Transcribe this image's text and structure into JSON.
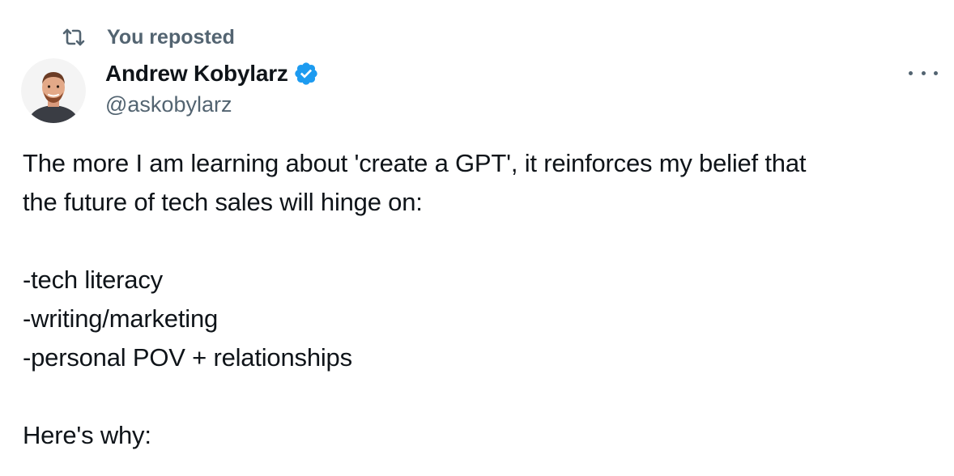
{
  "repost": {
    "icon": "repost-icon",
    "label": "You reposted"
  },
  "author": {
    "avatar_icon": "avatar",
    "display_name": "Andrew Kobylarz",
    "verified_icon": "verified-badge-icon",
    "handle": "@askobylarz"
  },
  "menu": {
    "icon": "more-options-icon"
  },
  "tweet": {
    "lines": [
      "The more I am learning about 'create a GPT', it reinforces my belief that",
      "the future of tech sales will hinge on:",
      "",
      "-tech literacy",
      "-writing/marketing",
      "-personal POV + relationships",
      "",
      "Here's why:"
    ]
  },
  "colors": {
    "text_primary": "#0f1419",
    "text_secondary": "#536471",
    "verified_blue": "#1d9bf0"
  }
}
